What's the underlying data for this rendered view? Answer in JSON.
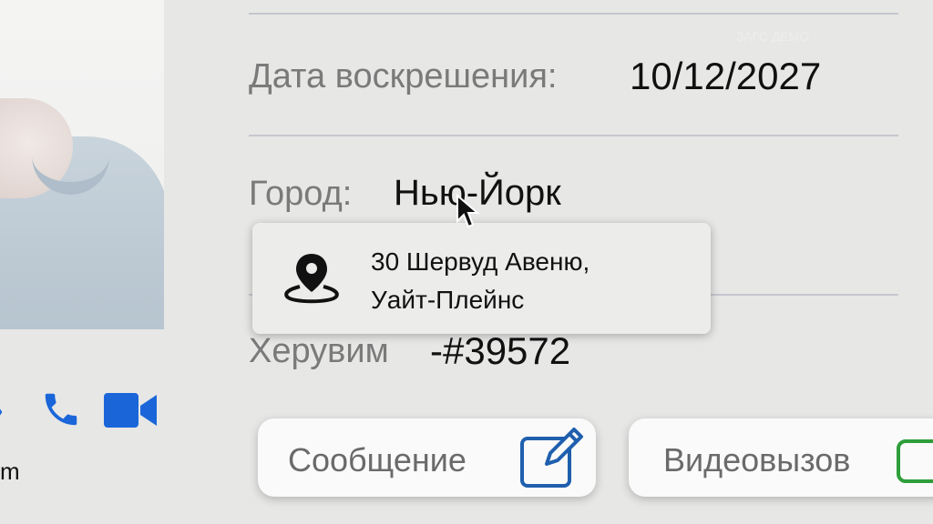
{
  "profile": {
    "resurrection_label": "Дата воскрешения:",
    "resurrection_date": "10/12/2027",
    "city_label": "Город:",
    "city_value": "Нью-Йорк",
    "cherub_label": "Херувим",
    "cherub_id": "-#39572"
  },
  "tooltip": {
    "icon": "location-pin-icon",
    "address_line1": "30 Шервуд Авеню,",
    "address_line2": "Уайт-Плейнс"
  },
  "contact": {
    "icons": [
      "phone-icon",
      "video-camera-icon"
    ],
    "partial_text": "m",
    "accent": "#1a66d9"
  },
  "buttons": {
    "message_label": "Сообщение",
    "video_call_label": "Видеовызов",
    "message_icon_color": "#1f5fae",
    "video_icon_color": "#2e9e3a"
  },
  "watermark": "ЗАГС ДЕМО"
}
